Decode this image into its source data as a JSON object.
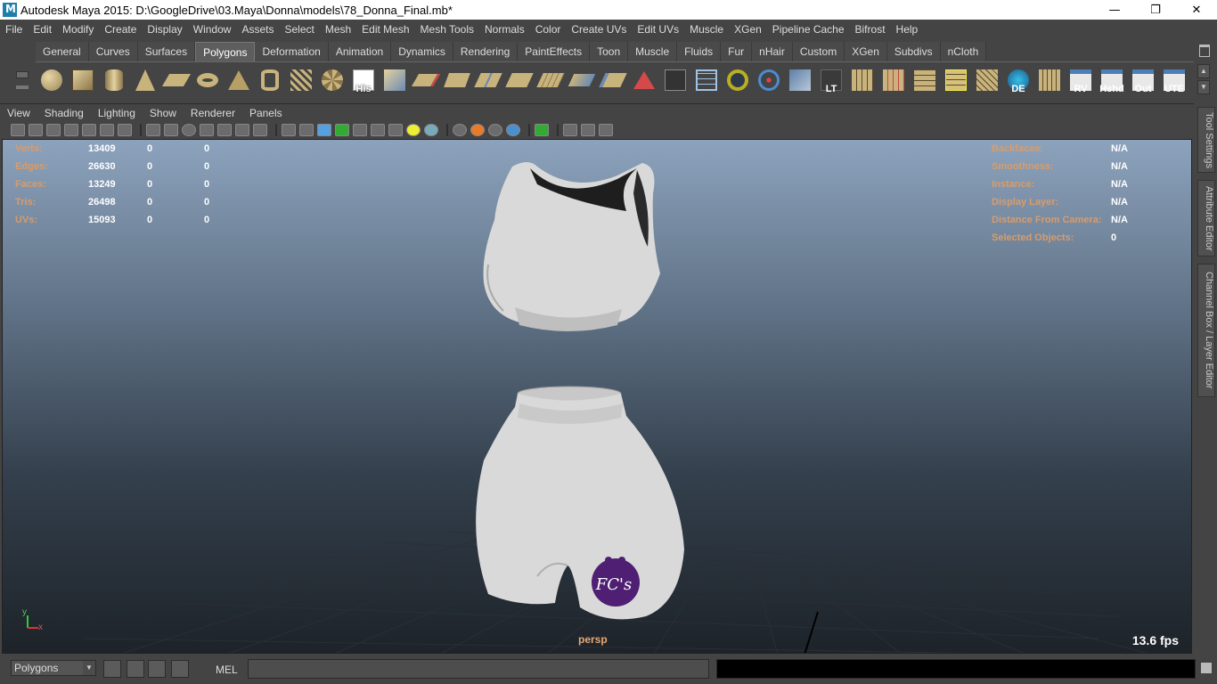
{
  "window": {
    "title": "Autodesk Maya 2015: D:\\GoogleDrive\\03.Maya\\Donna\\models\\78_Donna_Final.mb*",
    "minimize": "—",
    "maximize": "❐",
    "close": "✕"
  },
  "menubar": [
    "File",
    "Edit",
    "Modify",
    "Create",
    "Display",
    "Window",
    "Assets",
    "Select",
    "Mesh",
    "Edit Mesh",
    "Mesh Tools",
    "Normals",
    "Color",
    "Create UVs",
    "Edit UVs",
    "Muscle",
    "XGen",
    "Pipeline Cache",
    "Bifrost",
    "Help"
  ],
  "shelf": {
    "tabs": [
      "General",
      "Curves",
      "Surfaces",
      "Polygons",
      "Deformation",
      "Animation",
      "Dynamics",
      "Rendering",
      "PaintEffects",
      "Toon",
      "Muscle",
      "Fluids",
      "Fur",
      "nHair",
      "Custom",
      "XGen",
      "Subdivs",
      "nCloth"
    ],
    "active_tab": "Polygons",
    "icon_labels": {
      "his": "His",
      "lt": "LT",
      "de": "DE",
      "rv": "RV",
      "hshd": "Hshd",
      "out": "Out",
      "ute": "UTE"
    }
  },
  "panel_menu": [
    "View",
    "Shading",
    "Lighting",
    "Show",
    "Renderer",
    "Panels"
  ],
  "hud_left": [
    {
      "label": "Verts:",
      "v1": "13409",
      "v2": "0",
      "v3": "0"
    },
    {
      "label": "Edges:",
      "v1": "26630",
      "v2": "0",
      "v3": "0"
    },
    {
      "label": "Faces:",
      "v1": "13249",
      "v2": "0",
      "v3": "0"
    },
    {
      "label": "Tris:",
      "v1": "26498",
      "v2": "0",
      "v3": "0"
    },
    {
      "label": "UVs:",
      "v1": "15093",
      "v2": "0",
      "v3": "0"
    }
  ],
  "hud_right": [
    {
      "label": "Backfaces:",
      "value": "N/A"
    },
    {
      "label": "Smoothness:",
      "value": "N/A"
    },
    {
      "label": "Instance:",
      "value": "N/A"
    },
    {
      "label": "Display Layer:",
      "value": "N/A"
    },
    {
      "label": "Distance From Camera:",
      "value": "N/A"
    },
    {
      "label": "Selected Objects:",
      "value": "0"
    }
  ],
  "viewport": {
    "camera": "persp",
    "fps": "13.6 fps",
    "logo_text": "FC's",
    "axis_x": "x",
    "axis_y": "y"
  },
  "side_tabs": [
    "Tool Settings",
    "Attribute Editor",
    "Channel Box / Layer Editor"
  ],
  "cmdbar": {
    "mode": "Polygons",
    "mel": "MEL",
    "input": ""
  }
}
